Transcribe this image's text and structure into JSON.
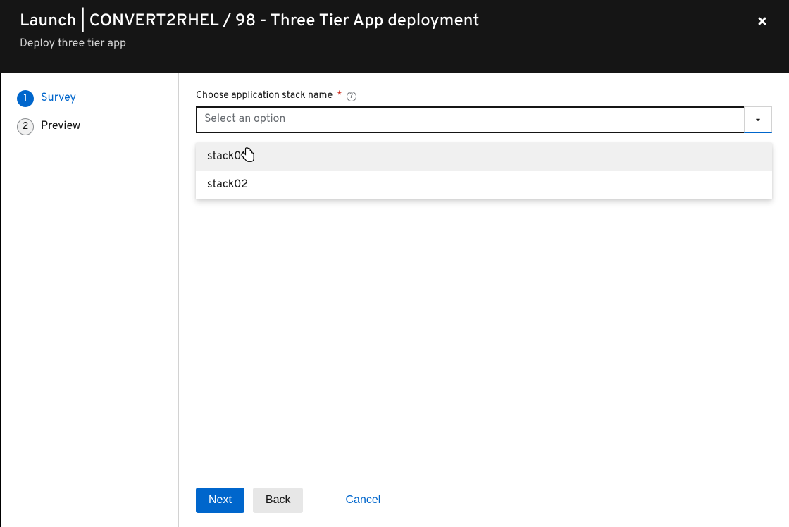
{
  "header": {
    "title": "Launch | CONVERT2RHEL / 98 - Three Tier App deployment",
    "subtitle": "Deploy three tier app"
  },
  "sidebar": {
    "steps": [
      {
        "num": "1",
        "label": "Survey",
        "active": true
      },
      {
        "num": "2",
        "label": "Preview",
        "active": false
      }
    ]
  },
  "form": {
    "field_label": "Choose application stack name",
    "placeholder": "Select an option",
    "options": [
      {
        "label": "stack01",
        "hovered": true
      },
      {
        "label": "stack02",
        "hovered": false
      }
    ]
  },
  "footer": {
    "next": "Next",
    "back": "Back",
    "cancel": "Cancel"
  }
}
